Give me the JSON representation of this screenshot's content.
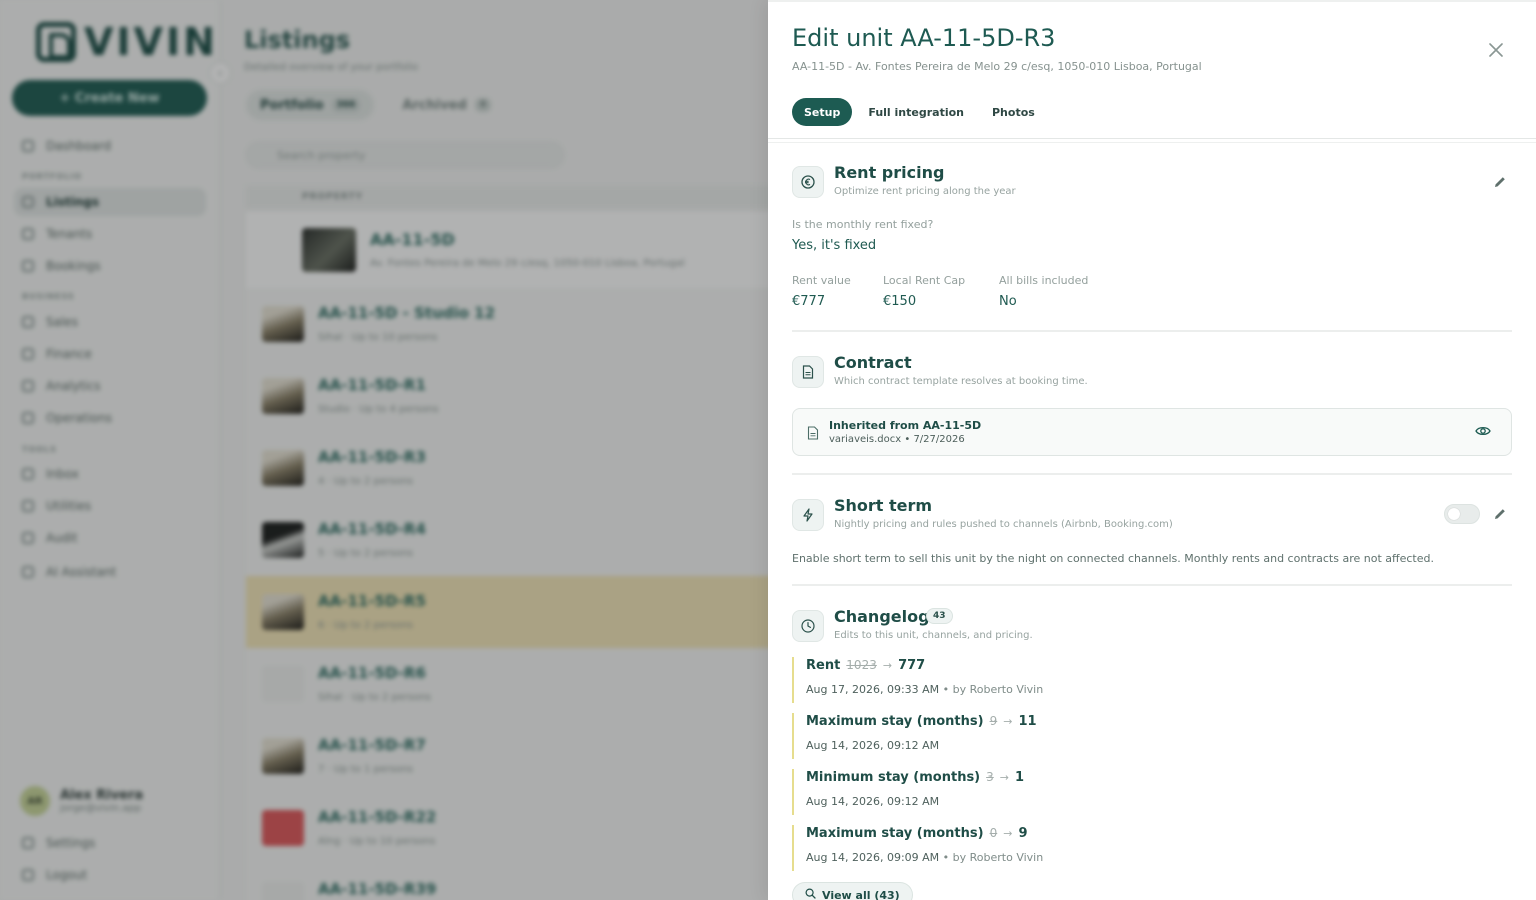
{
  "sidebar": {
    "logo_text": "VIVIN",
    "create_label": "+ Create New",
    "section_portfolio": "PORTFOLIO",
    "section_business": "BUSINESS",
    "section_tools": "TOOLS",
    "items": [
      {
        "label": "Dashboard"
      },
      {
        "label": "Listings"
      },
      {
        "label": "Tenants"
      },
      {
        "label": "Bookings"
      },
      {
        "label": "Sales"
      },
      {
        "label": "Finance"
      },
      {
        "label": "Analytics"
      },
      {
        "label": "Operations"
      },
      {
        "label": "Inbox"
      },
      {
        "label": "Utilities"
      },
      {
        "label": "Audit"
      },
      {
        "label": "AI Assistant"
      }
    ],
    "user": {
      "initials": "AR",
      "name": "Alex Rivera",
      "email": "jorge@vivin.app"
    },
    "settings_label": "Settings",
    "logout_label": "Logout"
  },
  "main": {
    "title": "Listings",
    "subtitle": "Detailed overview of your portfolio",
    "tabs": [
      {
        "label": "Portfolio",
        "count": "366"
      },
      {
        "label": "Archived",
        "count": "8"
      }
    ],
    "search_placeholder": "Search property",
    "column_property": "PROPERTY",
    "parent": {
      "name": "AA-11-5D",
      "address": "Av. Fontes Pereira de Melo 29 c/esq, 1050-010 Lisboa, Portugal"
    },
    "rows": [
      {
        "name": "AA-11-5D - Studio 12",
        "meta": "Sihal · Up to 10 persons"
      },
      {
        "name": "AA-11-5D-R1",
        "meta": "Studio · Up to 4 persons"
      },
      {
        "name": "AA-11-5D-R3",
        "meta": "4 · Up to 2 persons"
      },
      {
        "name": "AA-11-5D-R4",
        "meta": "5 · Up to 2 persons"
      },
      {
        "name": "AA-11-5D-R5",
        "meta": "6 · Up to 2 persons"
      },
      {
        "name": "AA-11-5D-R6",
        "meta": "Sihal · Up to 2 persons"
      },
      {
        "name": "AA-11-5D-R7",
        "meta": "7 · Up to 1 persons"
      },
      {
        "name": "AA-11-5D-R22",
        "meta": "Alng · Up to 10 persons"
      },
      {
        "name": "AA-11-5D-R39",
        "meta": ""
      }
    ]
  },
  "drawer": {
    "title": "Edit unit AA-11-5D-R3",
    "subtitle": "AA-11-5D - Av. Fontes Pereira de Melo 29 c/esq, 1050-010 Lisboa, Portugal",
    "close_icon": "close-icon",
    "tabs": [
      {
        "label": "Setup",
        "active": true
      },
      {
        "label": "Full integration",
        "active": false
      },
      {
        "label": "Photos",
        "active": false
      }
    ],
    "rent_pricing": {
      "title": "Rent pricing",
      "subtitle": "Optimize rent pricing along the year",
      "fixed_question": "Is the monthly rent fixed?",
      "fixed_answer": "Yes, it's fixed",
      "rent_value_label": "Rent value",
      "rent_value": "€777",
      "rent_cap_label": "Local Rent Cap",
      "rent_cap": "€150",
      "bills_label": "All bills included",
      "bills": "No"
    },
    "contract": {
      "title": "Contract",
      "subtitle": "Which contract template resolves at booking time.",
      "inherited": "Inherited from AA-11-5D",
      "file": "variaveis.docx • 7/27/2026"
    },
    "short_term": {
      "title": "Short term",
      "subtitle": "Nightly pricing and rules pushed to channels (Airbnb, Booking.com)",
      "enabled": false,
      "description": "Enable short term to sell this unit by the night on connected channels. Monthly rents and contracts are not affected."
    },
    "changelog": {
      "title": "Changelog",
      "count": "43",
      "subtitle": "Edits to this unit, channels, and pricing.",
      "entries": [
        {
          "field": "Rent",
          "old": "1023",
          "new": "777",
          "time": "Aug 17, 2026, 09:33 AM",
          "by": " • by Roberto Vivin"
        },
        {
          "field": "Maximum stay (months)",
          "old": "9",
          "new": "11",
          "time": "Aug 14, 2026, 09:12 AM",
          "by": ""
        },
        {
          "field": "Minimum stay (months)",
          "old": "3",
          "new": "1",
          "time": "Aug 14, 2026, 09:12 AM",
          "by": ""
        },
        {
          "field": "Maximum stay (months)",
          "old": "0",
          "new": "9",
          "time": "Aug 14, 2026, 09:09 AM",
          "by": " • by Roberto Vivin"
        }
      ],
      "view_all_label": "View all (43)"
    }
  },
  "colors": {
    "accent": "#1d5b52",
    "highlight_row": "#f5e7b9",
    "log_rule": "#e6dd8e"
  }
}
